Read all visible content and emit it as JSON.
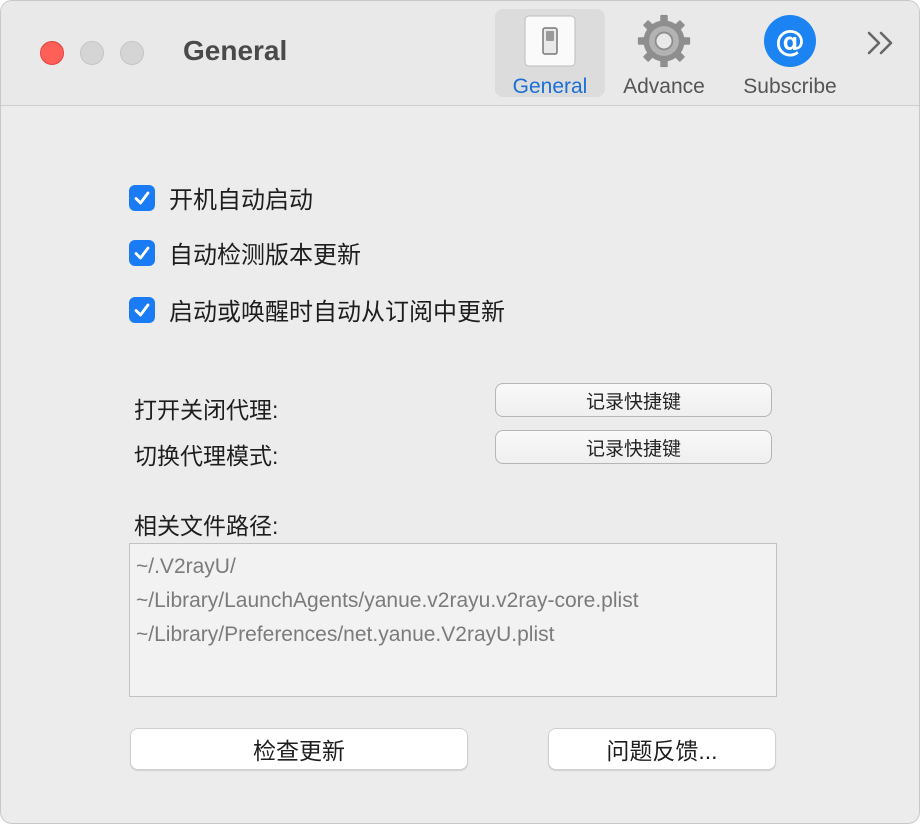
{
  "window": {
    "title": "General"
  },
  "toolbar": {
    "items": [
      {
        "label": "General",
        "icon": "switch-icon",
        "selected": true
      },
      {
        "label": "Advance",
        "icon": "gear-icon",
        "selected": false
      },
      {
        "label": "Subscribe",
        "icon": "at-sign-icon",
        "selected": false
      }
    ],
    "overflow_icon": "double-chevron-right-icon"
  },
  "options": [
    {
      "label": "开机自动启动",
      "checked": true
    },
    {
      "label": "自动检测版本更新",
      "checked": true
    },
    {
      "label": "启动或唤醒时自动从订阅中更新",
      "checked": true
    }
  ],
  "shortcuts": [
    {
      "label": "打开关闭代理:",
      "button": "记录快捷键"
    },
    {
      "label": "切换代理模式:",
      "button": "记录快捷键"
    }
  ],
  "files": {
    "label": "相关文件路径:",
    "paths": [
      "~/.V2rayU/",
      "~/Library/LaunchAgents/yanue.v2rayu.v2ray-core.plist",
      "~/Library/Preferences/net.yanue.V2rayU.plist"
    ]
  },
  "actions": {
    "check_update": "检查更新",
    "feedback": "问题反馈..."
  },
  "colors": {
    "accent": "#1a7cf5",
    "selected_tab_text": "#1a6fd6",
    "close_button": "#fe5f57"
  }
}
